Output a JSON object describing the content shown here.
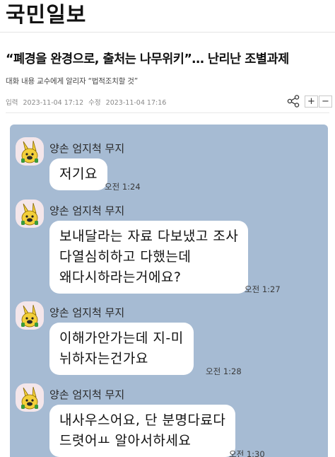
{
  "masthead": {
    "logo": "국민일보"
  },
  "article": {
    "headline": "“폐경을 완경으로, 출처는 나무위키”… 난리난 조별과제",
    "subhead": "대화 내용 교수에게 알리자 “법적조치할 것”",
    "meta": {
      "input_label": "입력",
      "input_time": "2023-11-04 17:12",
      "edit_label": "수정",
      "edit_time": "2023-11-04 17:16"
    }
  },
  "toolbar": {
    "share_icon": "share-icon",
    "zoom_in_label": "+",
    "zoom_out_label": "−"
  },
  "chat": {
    "background_color": "#a6bbd3",
    "bubble_color": "#ffffff",
    "messages": [
      {
        "sender": "양손 엄지척 무지",
        "lines": [
          "저기요"
        ],
        "time": "오전 1:24"
      },
      {
        "sender": "양손 엄지척 무지",
        "lines": [
          "보내달라는 자료 다보냈고 조사",
          "다열심히하고 다했는데",
          "왜다시하라는거에요?"
        ],
        "time": "오전 1:27"
      },
      {
        "sender": "양손 엄지척 무지",
        "lines": [
          "이해가안가는데 지-미",
          "뉘하자는건가요"
        ],
        "time": "오전 1:28"
      },
      {
        "sender": "양손 엄지척 무지",
        "lines": [
          "내사우스어요, 단 분명다료다",
          "드렷어ㅛ 알아서하세요"
        ],
        "time": "오전 1:30"
      }
    ]
  }
}
